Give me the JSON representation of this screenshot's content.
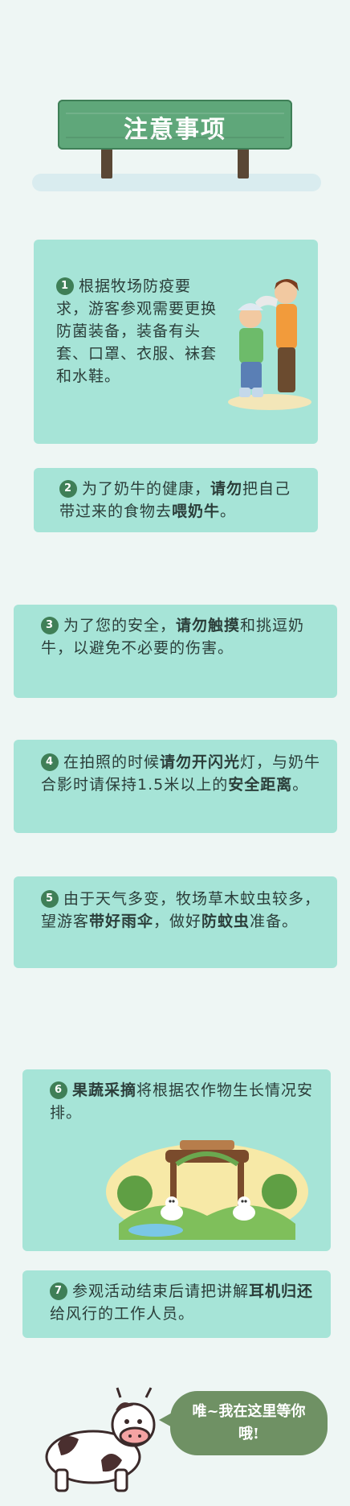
{
  "title": "注意事项",
  "items": [
    {
      "num": "1",
      "text_html": "根据牧场防疫要求，游客参观需要更换防菌装备，装备有头套、口罩、衣服、袜套和水鞋。"
    },
    {
      "num": "2",
      "text_html": "为了奶牛的健康，<b>请勿</b>把自己带过来的食物去<b>喂奶牛</b>。"
    },
    {
      "num": "3",
      "text_html": "为了您的安全，<b>请勿触摸</b>和挑逗奶牛，以避免不必要的伤害。"
    },
    {
      "num": "4",
      "text_html": "在拍照的时候<b>请勿开闪光</b>灯，与奶牛合影时请保持1.5米以上的<b>安全距离</b>。"
    },
    {
      "num": "5",
      "text_html": "由于天气多变，牧场草木蚊虫较多，望游客<b>带好雨伞</b>，做好<b>防蚊虫</b>准备。"
    },
    {
      "num": "6",
      "text_html": "<b>果蔬采摘</b>将根据农作物生长情况安排。"
    },
    {
      "num": "7",
      "text_html": "参观活动结束后请把讲解<b>耳机归还</b>给风行的工作人员。"
    }
  ],
  "bubble": "唯~我在这里等你哦!",
  "colors": {
    "card": "#a6e4d7",
    "sign": "#5fa77a",
    "badge": "#3f7f57",
    "bubble": "#6f9164"
  },
  "icons": [
    "visitors-illustration",
    "farm-gate-illustration",
    "cow-icon"
  ]
}
